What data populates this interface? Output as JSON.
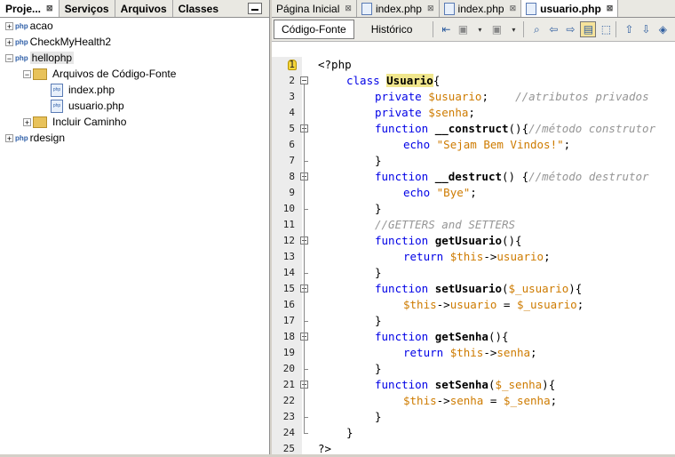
{
  "left_panel": {
    "tabs": [
      {
        "label": "Proje...",
        "active": true
      },
      {
        "label": "Serviços",
        "active": false
      },
      {
        "label": "Arquivos",
        "active": false
      },
      {
        "label": "Classes",
        "active": false
      }
    ],
    "tree": [
      {
        "label": "acao",
        "level": 0,
        "icon": "php-project-icon",
        "expand": "+"
      },
      {
        "label": "CheckMyHealth2",
        "level": 0,
        "icon": "php-project-icon",
        "expand": "+"
      },
      {
        "label": "hellophp",
        "level": 0,
        "icon": "php-project-icon",
        "expand": "-",
        "selected": true
      },
      {
        "label": "Arquivos de Código-Fonte",
        "level": 1,
        "icon": "source-folder-icon",
        "expand": "-"
      },
      {
        "label": "index.php",
        "level": 2,
        "icon": "php-file-icon",
        "expand": ""
      },
      {
        "label": "usuario.php",
        "level": 2,
        "icon": "php-file-icon",
        "expand": ""
      },
      {
        "label": "Incluir Caminho",
        "level": 1,
        "icon": "library-folder-icon",
        "expand": "+"
      },
      {
        "label": "rdesign",
        "level": 0,
        "icon": "php-project-icon",
        "expand": "+"
      }
    ]
  },
  "editor": {
    "tabs": [
      {
        "label": "Página Inicial",
        "active": false
      },
      {
        "label": "index.php",
        "active": false
      },
      {
        "label": "index.php",
        "active": false
      },
      {
        "label": "usuario.php",
        "active": true
      }
    ],
    "view_tabs": [
      {
        "label": "Código-Fonte",
        "active": true
      },
      {
        "label": "Histórico",
        "active": false
      }
    ],
    "toolbar_icons": [
      "back-icon",
      "forward-icon",
      "jump-icon",
      "search-icon",
      "find-prev-icon",
      "find-next-icon",
      "toggle-highlight-icon",
      "select-icon",
      "prev-bookmark-icon",
      "next-bookmark-icon",
      "toggle-bookmark-icon"
    ],
    "line_numbers": [
      "1",
      "2",
      "3",
      "4",
      "5",
      "6",
      "7",
      "8",
      "9",
      "10",
      "11",
      "12",
      "13",
      "14",
      "15",
      "16",
      "17",
      "18",
      "19",
      "20",
      "21",
      "22",
      "23",
      "24",
      "25"
    ],
    "code_lines": [
      [
        [
          "plain",
          "<?php"
        ]
      ],
      [
        [
          "kw",
          "class "
        ],
        [
          "hl",
          "Usuario"
        ],
        [
          "plain",
          "{"
        ]
      ],
      [
        [
          "kw",
          "private "
        ],
        [
          "var",
          "$usuario"
        ],
        [
          "plain",
          ";    "
        ],
        [
          "cm",
          "//atributos privados"
        ]
      ],
      [
        [
          "kw",
          "private "
        ],
        [
          "var",
          "$senha"
        ],
        [
          "plain",
          ";"
        ]
      ],
      [
        [
          "kw",
          "function "
        ],
        [
          "fn",
          "__construct"
        ],
        [
          "plain",
          "(){"
        ],
        [
          "cm",
          "//método construtor"
        ]
      ],
      [
        [
          "kw",
          "echo "
        ],
        [
          "str",
          "\"Sejam Bem Vindos!\""
        ],
        [
          "plain",
          ";"
        ]
      ],
      [
        [
          "plain",
          "}"
        ]
      ],
      [
        [
          "kw",
          "function "
        ],
        [
          "fn",
          "__destruct"
        ],
        [
          "plain",
          "() {"
        ],
        [
          "cm",
          "//método destrutor"
        ]
      ],
      [
        [
          "kw",
          "echo "
        ],
        [
          "str",
          "\"Bye\""
        ],
        [
          "plain",
          ";"
        ]
      ],
      [
        [
          "plain",
          "}"
        ]
      ],
      [
        [
          "cm",
          "//GETTERS and SETTERS"
        ]
      ],
      [
        [
          "kw",
          "function "
        ],
        [
          "fn",
          "getUsuario"
        ],
        [
          "plain",
          "(){"
        ]
      ],
      [
        [
          "kw",
          "return "
        ],
        [
          "var",
          "$this"
        ],
        [
          "plain",
          "->"
        ],
        [
          "var",
          "usuario"
        ],
        [
          "plain",
          ";"
        ]
      ],
      [
        [
          "plain",
          "}"
        ]
      ],
      [
        [
          "kw",
          "function "
        ],
        [
          "fn",
          "setUsuario"
        ],
        [
          "plain",
          "("
        ],
        [
          "var",
          "$_usuario"
        ],
        [
          "plain",
          "){"
        ]
      ],
      [
        [
          "var",
          "$this"
        ],
        [
          "plain",
          "->"
        ],
        [
          "var",
          "usuario"
        ],
        [
          "plain",
          " = "
        ],
        [
          "var",
          "$_usuario"
        ],
        [
          "plain",
          ";"
        ]
      ],
      [
        [
          "plain",
          "}"
        ]
      ],
      [
        [
          "kw",
          "function "
        ],
        [
          "fn",
          "getSenha"
        ],
        [
          "plain",
          "(){"
        ]
      ],
      [
        [
          "kw",
          "return "
        ],
        [
          "var",
          "$this"
        ],
        [
          "plain",
          "->"
        ],
        [
          "var",
          "senha"
        ],
        [
          "plain",
          ";"
        ]
      ],
      [
        [
          "plain",
          "}"
        ]
      ],
      [
        [
          "kw",
          "function "
        ],
        [
          "fn",
          "setSenha"
        ],
        [
          "plain",
          "("
        ],
        [
          "var",
          "$_senha"
        ],
        [
          "plain",
          "){"
        ]
      ],
      [
        [
          "var",
          "$this"
        ],
        [
          "plain",
          "->"
        ],
        [
          "var",
          "senha"
        ],
        [
          "plain",
          " = "
        ],
        [
          "var",
          "$_senha"
        ],
        [
          "plain",
          ";"
        ]
      ],
      [
        [
          "plain",
          "}"
        ]
      ],
      [
        [
          "plain",
          "}"
        ]
      ],
      [
        [
          "plain",
          "?>"
        ]
      ]
    ]
  }
}
